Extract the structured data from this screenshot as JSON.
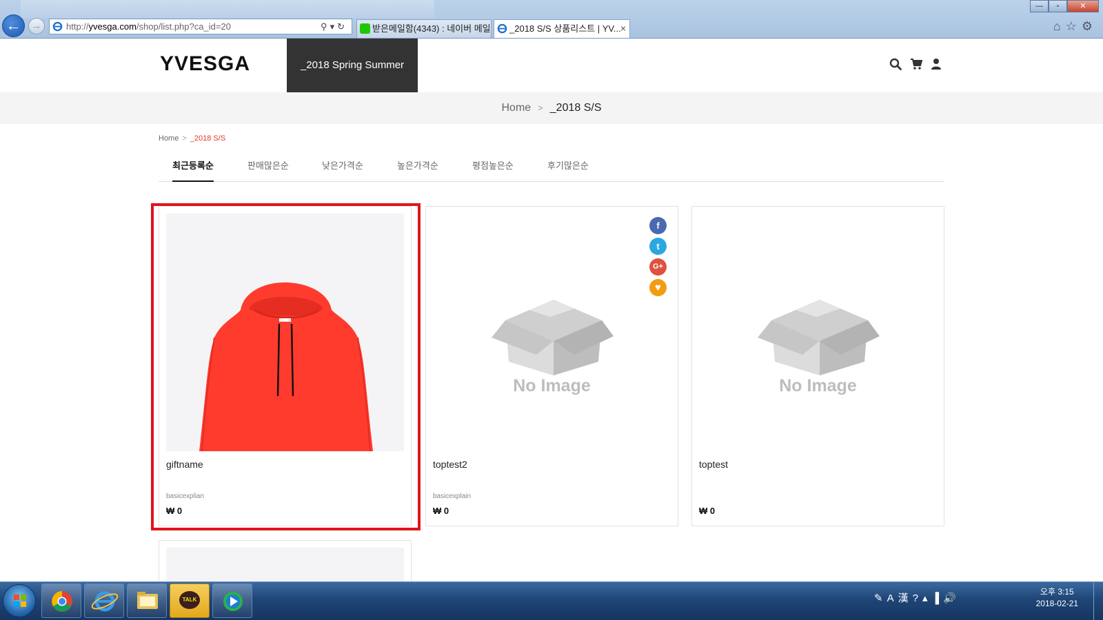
{
  "browser": {
    "url_prefix": "http://",
    "url_host": "yvesga.com",
    "url_path": "/shop/list.php?ca_id=20",
    "tabs": [
      {
        "label": "받은메일함(4343) : 네이버 메일"
      },
      {
        "label": "_2018 S/S 상품리스트 | YV..."
      }
    ],
    "tab_close": "×",
    "window_buttons": {
      "minimize": "—",
      "maximize": "▫",
      "close": "✕"
    }
  },
  "site": {
    "logo": "YVESGA",
    "nav_item": "_2018 Spring Summer",
    "subhead": {
      "home": "Home",
      "separator": ">",
      "current": "_2018 S/S"
    },
    "breadcrumb": {
      "home": "Home",
      "separator": ">",
      "current": "_2018 S/S"
    },
    "sort_tabs": [
      {
        "label": "최근등록순"
      },
      {
        "label": "판매많은순"
      },
      {
        "label": "낮은가격순"
      },
      {
        "label": "높은가격순"
      },
      {
        "label": "평점높은순"
      },
      {
        "label": "후기많은순"
      }
    ],
    "products": [
      {
        "name": "giftname",
        "desc": "basicexplian",
        "price": "₩ 0",
        "image": "red-hoodie"
      },
      {
        "name": "toptest2",
        "desc": "basicexplain",
        "price": "₩ 0",
        "image": "no-image",
        "no_image_text": "No Image"
      },
      {
        "name": "toptest",
        "desc": "",
        "price": "₩ 0",
        "image": "no-image",
        "no_image_text": "No Image"
      }
    ],
    "sns_buttons": [
      {
        "icon": "facebook-icon",
        "label": "f",
        "color": "#3b5998"
      },
      {
        "icon": "twitter-icon",
        "label": "t",
        "color": "#1da1f2"
      },
      {
        "icon": "googleplus-icon",
        "label": "G+",
        "color": "#dd4b39"
      },
      {
        "icon": "heart-icon",
        "label": "♥",
        "color": "#f39c12"
      }
    ],
    "accent_color": "#e2362c",
    "highlight_color": "#e0151b"
  },
  "taskbar": {
    "clock_time": "오후 3:15",
    "clock_date": "2018-02-21",
    "apps": [
      "chrome",
      "internet-explorer",
      "file-explorer",
      "kakaotalk",
      "media-player"
    ],
    "kakao_label": "TALK"
  }
}
